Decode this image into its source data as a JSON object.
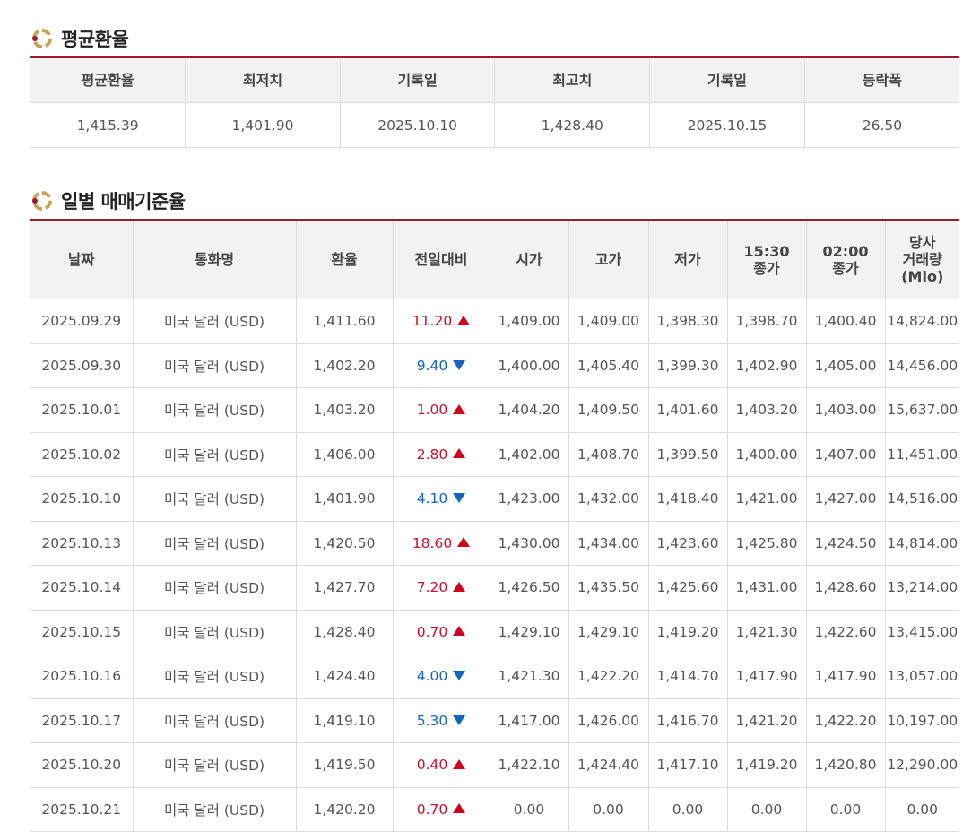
{
  "sections": {
    "avg_title": "평균환율",
    "daily_title": "일별 매매기준율"
  },
  "colors": {
    "accent": "#9b1b30",
    "up": "#c8102e",
    "down": "#1565c0"
  },
  "avg_table": {
    "headers": [
      "평균환율",
      "최저치",
      "기록일",
      "최고치",
      "기록일",
      "등락폭"
    ],
    "values": [
      "1,415.39",
      "1,401.90",
      "2025.10.10",
      "1,428.40",
      "2025.10.15",
      "26.50"
    ]
  },
  "daily_table": {
    "headers": [
      "날짜",
      "통화명",
      "환율",
      "전일대비",
      "시가",
      "고가",
      "저가",
      "15:30\n종가",
      "02:00\n종가",
      "당사\n거래량\n(Mio)"
    ],
    "rows": [
      {
        "date": "2025.09.29",
        "currency": "미국 달러 (USD)",
        "rate": "1,411.60",
        "change": "11.20",
        "dir": "up",
        "open": "1,409.00",
        "high": "1,409.00",
        "low": "1,398.30",
        "close1530": "1,398.70",
        "close0200": "1,400.40",
        "volume": "14,824.00"
      },
      {
        "date": "2025.09.30",
        "currency": "미국 달러 (USD)",
        "rate": "1,402.20",
        "change": "9.40",
        "dir": "down",
        "open": "1,400.00",
        "high": "1,405.40",
        "low": "1,399.30",
        "close1530": "1,402.90",
        "close0200": "1,405.00",
        "volume": "14,456.00"
      },
      {
        "date": "2025.10.01",
        "currency": "미국 달러 (USD)",
        "rate": "1,403.20",
        "change": "1.00",
        "dir": "up",
        "open": "1,404.20",
        "high": "1,409.50",
        "low": "1,401.60",
        "close1530": "1,403.20",
        "close0200": "1,403.00",
        "volume": "15,637.00"
      },
      {
        "date": "2025.10.02",
        "currency": "미국 달러 (USD)",
        "rate": "1,406.00",
        "change": "2.80",
        "dir": "up",
        "open": "1,402.00",
        "high": "1,408.70",
        "low": "1,399.50",
        "close1530": "1,400.00",
        "close0200": "1,407.00",
        "volume": "11,451.00"
      },
      {
        "date": "2025.10.10",
        "currency": "미국 달러 (USD)",
        "rate": "1,401.90",
        "change": "4.10",
        "dir": "down",
        "open": "1,423.00",
        "high": "1,432.00",
        "low": "1,418.40",
        "close1530": "1,421.00",
        "close0200": "1,427.00",
        "volume": "14,516.00"
      },
      {
        "date": "2025.10.13",
        "currency": "미국 달러 (USD)",
        "rate": "1,420.50",
        "change": "18.60",
        "dir": "up",
        "open": "1,430.00",
        "high": "1,434.00",
        "low": "1,423.60",
        "close1530": "1,425.80",
        "close0200": "1,424.50",
        "volume": "14,814.00"
      },
      {
        "date": "2025.10.14",
        "currency": "미국 달러 (USD)",
        "rate": "1,427.70",
        "change": "7.20",
        "dir": "up",
        "open": "1,426.50",
        "high": "1,435.50",
        "low": "1,425.60",
        "close1530": "1,431.00",
        "close0200": "1,428.60",
        "volume": "13,214.00"
      },
      {
        "date": "2025.10.15",
        "currency": "미국 달러 (USD)",
        "rate": "1,428.40",
        "change": "0.70",
        "dir": "up",
        "open": "1,429.10",
        "high": "1,429.10",
        "low": "1,419.20",
        "close1530": "1,421.30",
        "close0200": "1,422.60",
        "volume": "13,415.00"
      },
      {
        "date": "2025.10.16",
        "currency": "미국 달러 (USD)",
        "rate": "1,424.40",
        "change": "4.00",
        "dir": "down",
        "open": "1,421.30",
        "high": "1,422.20",
        "low": "1,414.70",
        "close1530": "1,417.90",
        "close0200": "1,417.90",
        "volume": "13,057.00"
      },
      {
        "date": "2025.10.17",
        "currency": "미국 달러 (USD)",
        "rate": "1,419.10",
        "change": "5.30",
        "dir": "down",
        "open": "1,417.00",
        "high": "1,426.00",
        "low": "1,416.70",
        "close1530": "1,421.20",
        "close0200": "1,422.20",
        "volume": "10,197.00"
      },
      {
        "date": "2025.10.20",
        "currency": "미국 달러 (USD)",
        "rate": "1,419.50",
        "change": "0.40",
        "dir": "up",
        "open": "1,422.10",
        "high": "1,424.40",
        "low": "1,417.10",
        "close1530": "1,419.20",
        "close0200": "1,420.80",
        "volume": "12,290.00"
      },
      {
        "date": "2025.10.21",
        "currency": "미국 달러 (USD)",
        "rate": "1,420.20",
        "change": "0.70",
        "dir": "up",
        "open": "0.00",
        "high": "0.00",
        "low": "0.00",
        "close1530": "0.00",
        "close0200": "0.00",
        "volume": "0.00"
      }
    ]
  }
}
